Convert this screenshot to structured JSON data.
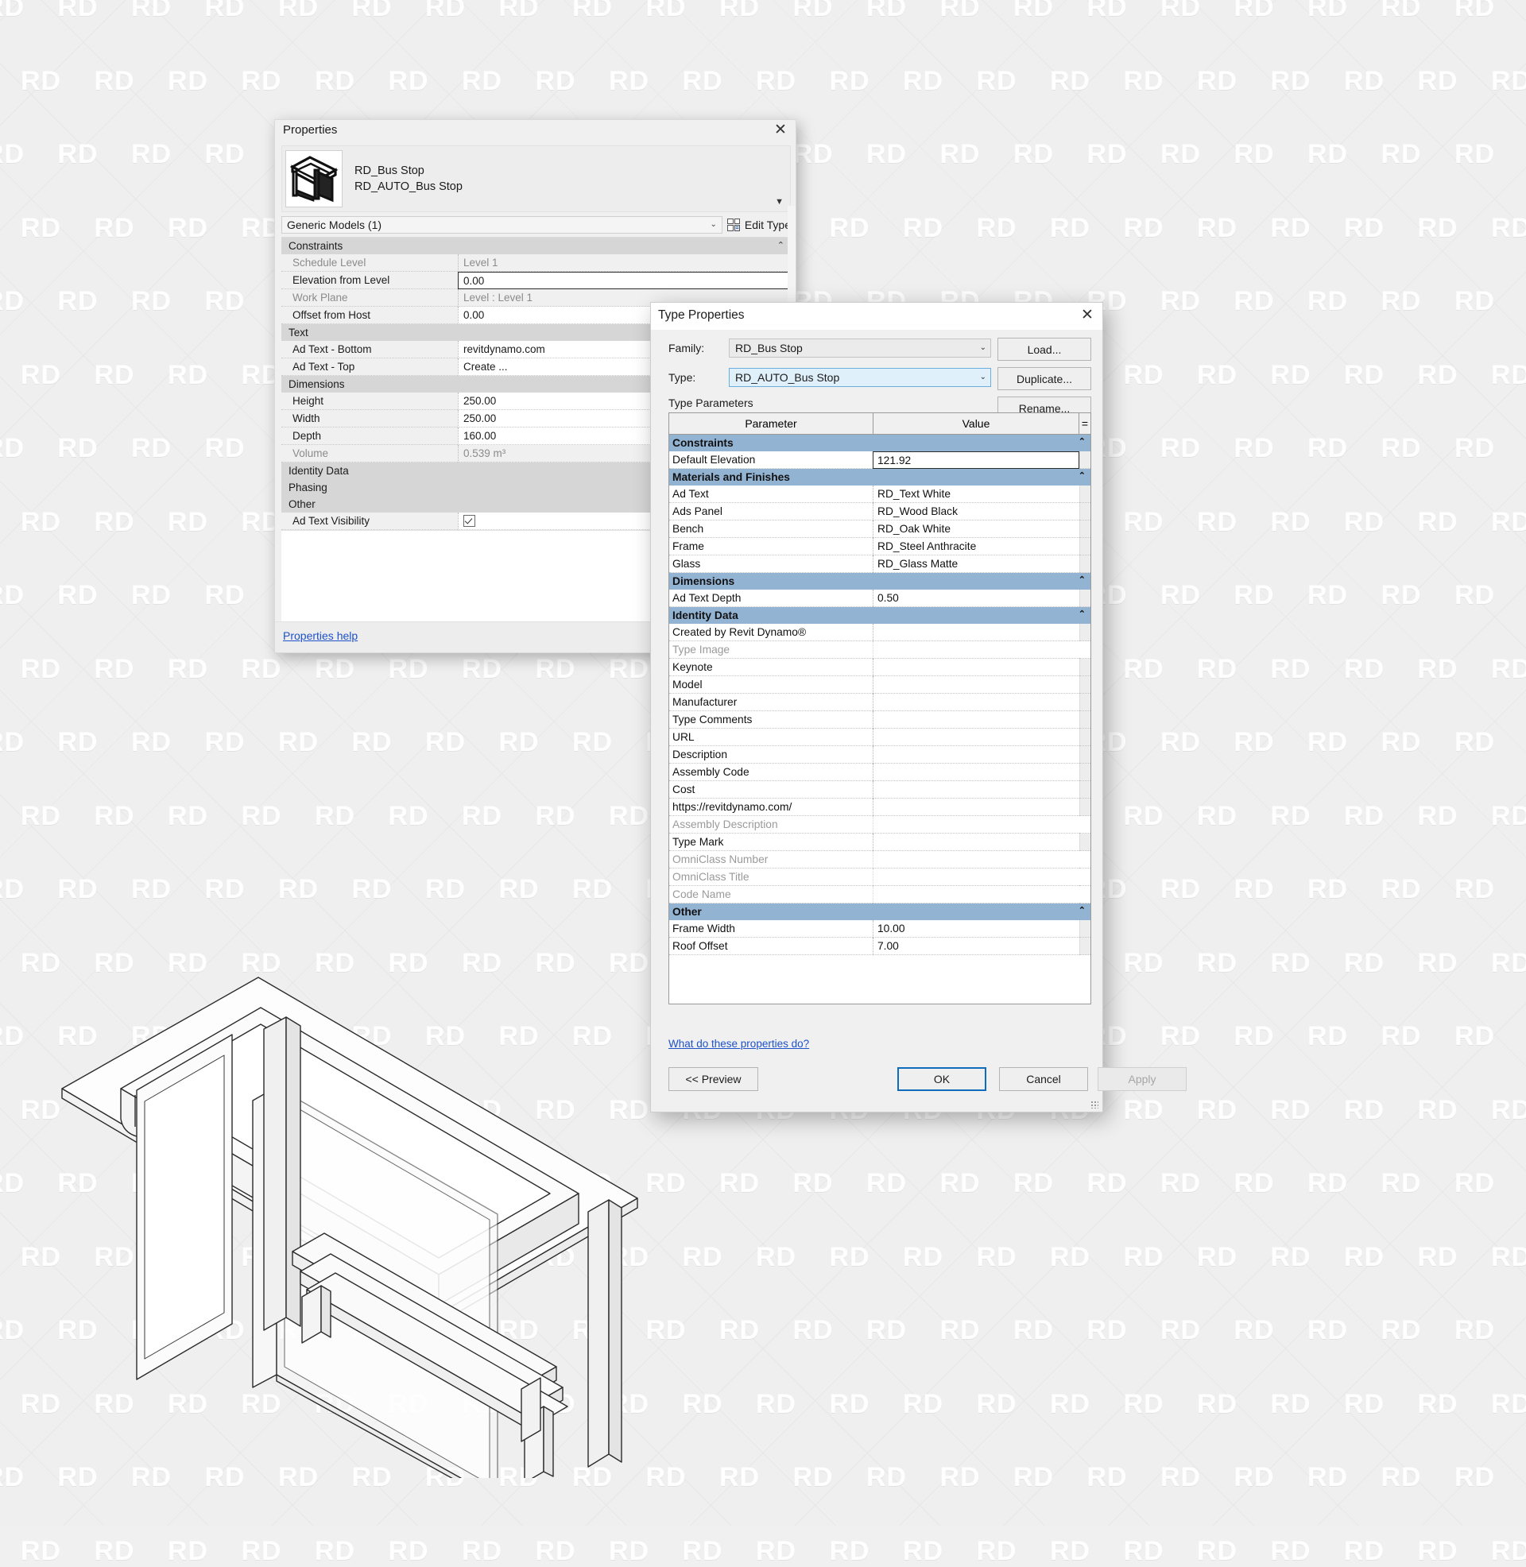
{
  "watermark": {
    "text": "RD"
  },
  "properties_panel": {
    "title": "Properties",
    "close_icon": "✕",
    "family_name": "RD_Bus Stop",
    "type_name": "RD_AUTO_Bus Stop",
    "category_selector": "Generic Models (1)",
    "edit_type_label": "Edit Type",
    "edit_type_icon": "edit-type-icon",
    "help_link": "Properties help",
    "groups": [
      {
        "name": "Constraints",
        "rows": [
          {
            "name": "Schedule Level",
            "value": "Level 1",
            "readonly": true
          },
          {
            "name": "Elevation from Level",
            "value": "0.00",
            "focused": true
          },
          {
            "name": "Work Plane",
            "value": "Level : Level 1",
            "readonly": true
          },
          {
            "name": "Offset from Host",
            "value": "0.00"
          }
        ]
      },
      {
        "name": "Text",
        "rows": [
          {
            "name": "Ad Text - Bottom",
            "value": "revitdynamo.com"
          },
          {
            "name": "Ad Text - Top",
            "value": "Create ..."
          }
        ]
      },
      {
        "name": "Dimensions",
        "rows": [
          {
            "name": "Height",
            "value": "250.00"
          },
          {
            "name": "Width",
            "value": "250.00"
          },
          {
            "name": "Depth",
            "value": "160.00"
          },
          {
            "name": "Volume",
            "value": "0.539 m³",
            "readonly": true
          }
        ]
      },
      {
        "name": "Identity Data",
        "rows": []
      },
      {
        "name": "Phasing",
        "rows": []
      },
      {
        "name": "Other",
        "rows": [
          {
            "name": "Ad Text Visibility",
            "value": "",
            "checkbox": true,
            "checked": true
          }
        ]
      }
    ]
  },
  "type_properties_dialog": {
    "title": "Type Properties",
    "close_icon": "✕",
    "family_label": "Family:",
    "family_value": "RD_Bus Stop",
    "type_label": "Type:",
    "type_value": "RD_AUTO_Bus Stop",
    "buttons": {
      "load": "Load...",
      "duplicate": "Duplicate...",
      "rename": "Rename...",
      "preview": "<< Preview",
      "ok": "OK",
      "cancel": "Cancel",
      "apply": "Apply"
    },
    "type_parameters_label": "Type Parameters",
    "table_headers": {
      "parameter": "Parameter",
      "value": "Value",
      "equals": "="
    },
    "help_link": "What do these properties do?",
    "sections": [
      {
        "name": "Constraints",
        "rows": [
          {
            "parameter": "Default Elevation",
            "value": "121.92",
            "edit": true
          }
        ]
      },
      {
        "name": "Materials and Finishes",
        "rows": [
          {
            "parameter": "Ad Text",
            "value": "RD_Text White"
          },
          {
            "parameter": "Ads Panel",
            "value": "RD_Wood Black"
          },
          {
            "parameter": "Bench",
            "value": "RD_Oak White"
          },
          {
            "parameter": "Frame",
            "value": "RD_Steel Anthracite"
          },
          {
            "parameter": "Glass",
            "value": "RD_Glass Matte"
          }
        ]
      },
      {
        "name": "Dimensions",
        "rows": [
          {
            "parameter": "Ad Text Depth",
            "value": "0.50"
          }
        ]
      },
      {
        "name": "Identity Data",
        "rows": [
          {
            "parameter": "Created by Revit Dynamo®",
            "value": ""
          },
          {
            "parameter": "Type Image",
            "value": "",
            "readonly": true
          },
          {
            "parameter": "Keynote",
            "value": ""
          },
          {
            "parameter": "Model",
            "value": ""
          },
          {
            "parameter": "Manufacturer",
            "value": ""
          },
          {
            "parameter": "Type Comments",
            "value": ""
          },
          {
            "parameter": "URL",
            "value": ""
          },
          {
            "parameter": "Description",
            "value": ""
          },
          {
            "parameter": "Assembly Code",
            "value": ""
          },
          {
            "parameter": "Cost",
            "value": ""
          },
          {
            "parameter": "https://revitdynamo.com/",
            "value": ""
          },
          {
            "parameter": "Assembly Description",
            "value": "",
            "readonly": true
          },
          {
            "parameter": "Type Mark",
            "value": ""
          },
          {
            "parameter": "OmniClass Number",
            "value": "",
            "readonly": true
          },
          {
            "parameter": "OmniClass Title",
            "value": "",
            "readonly": true
          },
          {
            "parameter": "Code Name",
            "value": "",
            "readonly": true
          }
        ]
      },
      {
        "name": "Other",
        "rows": [
          {
            "parameter": "Frame Width",
            "value": "10.00"
          },
          {
            "parameter": "Roof Offset",
            "value": "7.00"
          }
        ]
      }
    ]
  },
  "colors": {
    "section_header": "#93b3d3",
    "group_header": "#d6d6d6",
    "accent_link": "#1e52c8",
    "primary_button_border": "#0f6cbd",
    "combo_active": "#dff0fb"
  }
}
